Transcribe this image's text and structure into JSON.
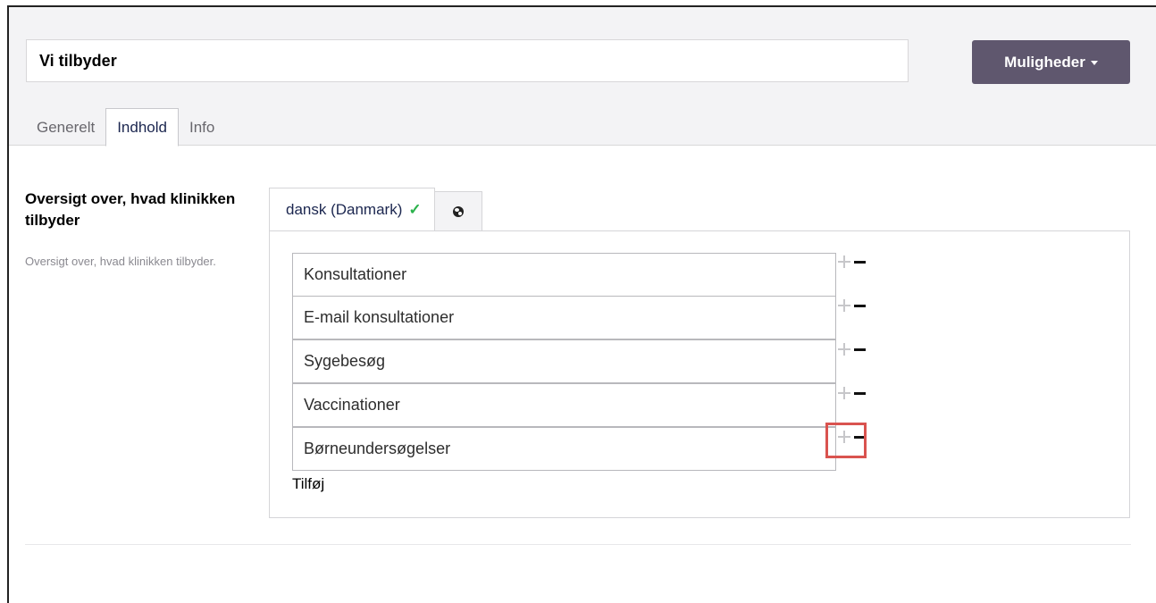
{
  "header": {
    "title_value": "Vi tilbyder",
    "options_label": "Muligheder",
    "tabs": [
      {
        "label": "Generelt"
      },
      {
        "label": "Indhold"
      },
      {
        "label": "Info"
      }
    ]
  },
  "field": {
    "label": "Oversigt over, hvad klinikken tilbyder",
    "description": "Oversigt over, hvad klinikken tilbyder."
  },
  "language_tabs": {
    "active_label": "dansk (Danmark)",
    "active_check": "✓",
    "globe_icon": "globe-icon"
  },
  "items": [
    {
      "value": "Konsultationer"
    },
    {
      "value": "E-mail konsultationer"
    },
    {
      "value": "Sygebesøg"
    },
    {
      "value": "Vaccinationer"
    },
    {
      "value": "Børneundersøgelser"
    }
  ],
  "add_label": "Tilføj",
  "colors": {
    "primary_button": "#5f576e",
    "check": "#2bb24c",
    "highlight": "#d9534f"
  }
}
